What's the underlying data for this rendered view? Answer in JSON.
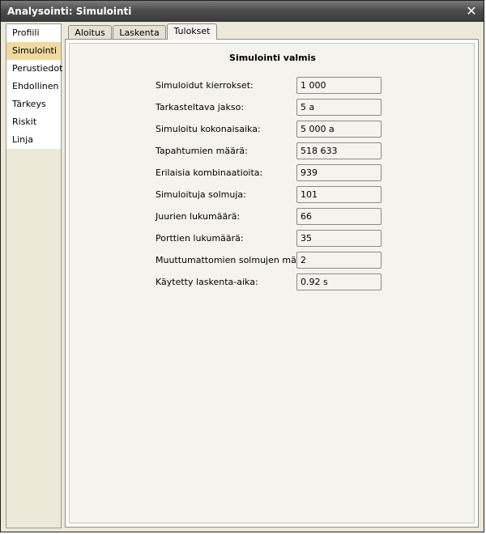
{
  "window": {
    "title": "Analysointi: Simulointi",
    "close_label": "✕"
  },
  "sidebar": {
    "items": [
      {
        "label": "Profiili",
        "active": false
      },
      {
        "label": "Simulointi",
        "active": true
      },
      {
        "label": "Perustiedot",
        "active": false
      },
      {
        "label": "Ehdollinen",
        "active": false
      },
      {
        "label": "Tärkeys",
        "active": false
      },
      {
        "label": "Riskit",
        "active": false
      },
      {
        "label": "Linja",
        "active": false
      }
    ]
  },
  "tabs": [
    {
      "label": "Aloitus",
      "active": false
    },
    {
      "label": "Laskenta",
      "active": false
    },
    {
      "label": "Tulokset",
      "active": true
    }
  ],
  "results": {
    "title": "Simulointi valmis",
    "rows": [
      {
        "label": "Simuloidut kierrokset:",
        "value": "1 000"
      },
      {
        "label": "Tarkasteltava jakso:",
        "value": "5 a"
      },
      {
        "label": "Simuloitu kokonaisaika:",
        "value": "5 000 a"
      },
      {
        "label": "Tapahtumien määrä:",
        "value": "518 633"
      },
      {
        "label": "Erilaisia kombinaatioita:",
        "value": "939"
      },
      {
        "label": "Simuloituja solmuja:",
        "value": "101"
      },
      {
        "label": "Juurien lukumäärä:",
        "value": "66"
      },
      {
        "label": "Porttien lukumäärä:",
        "value": "35"
      },
      {
        "label": "Muuttumattomien solmujen määrä:",
        "value": "2"
      },
      {
        "label": "Käytetty laskenta-aika:",
        "value": "0.92 s"
      }
    ]
  }
}
